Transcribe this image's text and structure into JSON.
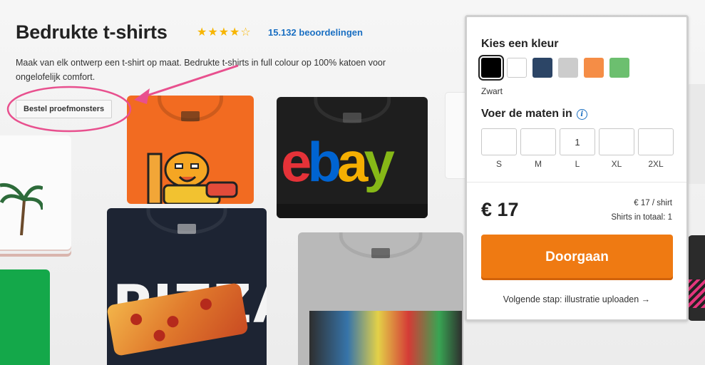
{
  "header": {
    "title": "Bedrukte t-shirts",
    "rating_stars": "★★★★☆",
    "reviews_link": "15.132 beoordelingen",
    "description": "Maak van elk ontwerp een t-shirt op maat. Bedrukte t-shirts in full colour op 100% katoen voor ongelofelijk comfort.",
    "sample_button": "Bestel proefmonsters"
  },
  "product_art": {
    "ebay_e": "e",
    "ebay_b": "b",
    "ebay_a": "a",
    "ebay_y": "y",
    "pizza": "PIZZA"
  },
  "colors": {
    "accent_orange": "#ef7a12",
    "link_blue": "#1a6fc2",
    "annotation_pink": "#e8508e",
    "star_yellow": "#f7b500"
  },
  "panel": {
    "color_title": "Kies een kleur",
    "swatches": [
      {
        "name": "Zwart",
        "hex": "#000000",
        "selected": true
      },
      {
        "name": "wit",
        "hex": "#ffffff",
        "selected": false
      },
      {
        "name": "navy",
        "hex": "#2c4566",
        "selected": false
      },
      {
        "name": "grijs",
        "hex": "#cccccc",
        "selected": false
      },
      {
        "name": "oranje",
        "hex": "#f58d46",
        "selected": false
      },
      {
        "name": "groen",
        "hex": "#6cbf6f",
        "selected": false
      }
    ],
    "selected_color": "Zwart",
    "size_title": "Voer de maten in",
    "info_icon": "i",
    "sizes": [
      {
        "label": "S",
        "value": ""
      },
      {
        "label": "M",
        "value": ""
      },
      {
        "label": "L",
        "value": "1"
      },
      {
        "label": "XL",
        "value": ""
      },
      {
        "label": "2XL",
        "value": ""
      }
    ],
    "price": "€ 17",
    "unit_price": "€ 17 / shirt",
    "total_shirts": "Shirts in totaal: 1",
    "cta_label": "Doorgaan",
    "next_step": "Volgende stap: illustratie uploaden →"
  }
}
